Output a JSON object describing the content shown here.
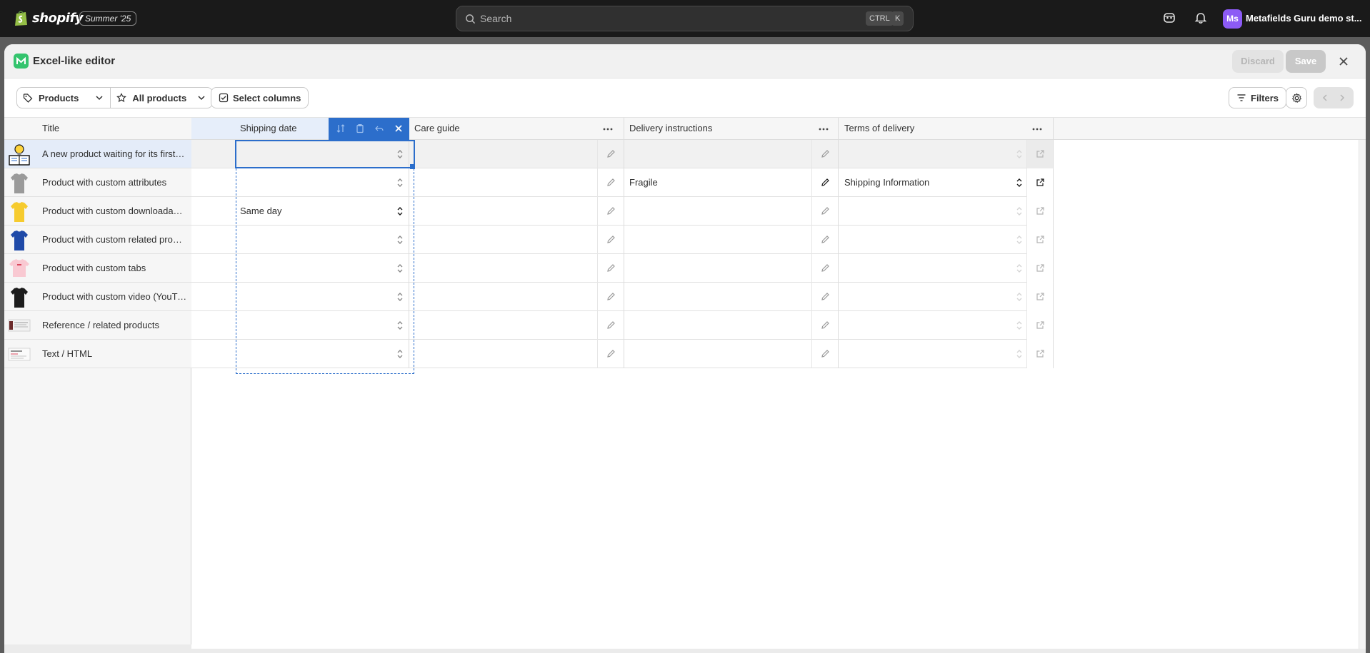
{
  "topbar": {
    "brand": "shopify",
    "edition": "Summer '25",
    "search_placeholder": "Search",
    "shortcut_keys": [
      "CTRL",
      "K"
    ],
    "avatar_initials": "Ms",
    "store_name": "Metafields Guru demo st..."
  },
  "modal": {
    "title": "Excel-like editor",
    "discard_label": "Discard",
    "save_label": "Save"
  },
  "toolbar": {
    "resource_label": "Products",
    "view_label": "All products",
    "select_columns_label": "Select columns",
    "filters_label": "Filters"
  },
  "grid": {
    "columns": {
      "title": "Title",
      "shipping_date": "Shipping date",
      "care_guide": "Care guide",
      "delivery_instructions": "Delivery instructions",
      "terms_of_delivery": "Terms of delivery"
    },
    "rows": [
      {
        "title": "A new product waiting for its first metafields",
        "thumb": "lightbulb-book",
        "shipping_date": "",
        "care_guide": "",
        "delivery_instructions": "",
        "terms_of_delivery": ""
      },
      {
        "title": "Product with custom attributes",
        "thumb": "grey-tshirt",
        "shipping_date": "",
        "care_guide": "",
        "delivery_instructions": "Fragile",
        "terms_of_delivery": "Shipping Information"
      },
      {
        "title": "Product with custom downloadable (PDF)",
        "thumb": "yellow-tshirt",
        "shipping_date": "Same day",
        "care_guide": "",
        "delivery_instructions": "",
        "terms_of_delivery": ""
      },
      {
        "title": "Product with custom related products",
        "thumb": "blue-tshirt",
        "shipping_date": "",
        "care_guide": "",
        "delivery_instructions": "",
        "terms_of_delivery": ""
      },
      {
        "title": "Product with custom tabs",
        "thumb": "pink-tshirt",
        "shipping_date": "",
        "care_guide": "",
        "delivery_instructions": "",
        "terms_of_delivery": ""
      },
      {
        "title": "Product with custom video (YouTube)",
        "thumb": "black-tshirt",
        "shipping_date": "",
        "care_guide": "",
        "delivery_instructions": "",
        "terms_of_delivery": ""
      },
      {
        "title": "Reference / related products",
        "thumb": "screenshot-thumbnail",
        "shipping_date": "",
        "care_guide": "",
        "delivery_instructions": "",
        "terms_of_delivery": ""
      },
      {
        "title": "Text / HTML",
        "thumb": "document-thumbnail",
        "shipping_date": "",
        "care_guide": "",
        "delivery_instructions": "",
        "terms_of_delivery": ""
      }
    ]
  },
  "colors": {
    "accent": "#2c6ecb",
    "topbar_bg": "#1a1a1a",
    "avatar": "#8c5bf5",
    "app_logo": "#34c46e"
  }
}
